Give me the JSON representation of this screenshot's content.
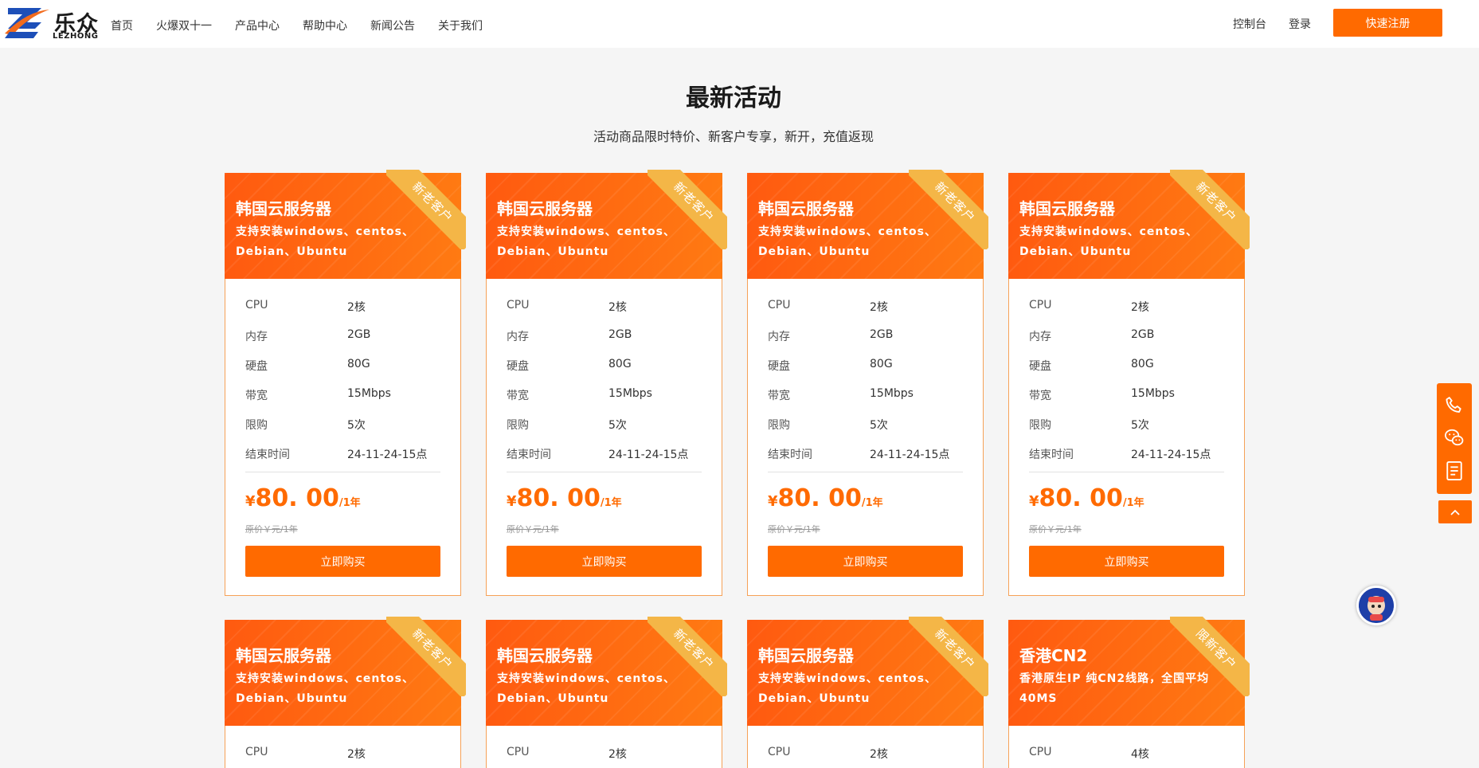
{
  "header": {
    "logo_text": "乐众",
    "logo_sub": "LEZHONG",
    "nav": [
      "首页",
      "火爆双十一",
      "产品中心",
      "帮助中心",
      "新闻公告",
      "关于我们"
    ],
    "console": "控制台",
    "login": "登录",
    "register": "快速注册"
  },
  "section": {
    "title": "最新活动",
    "subtitle": "活动商品限时特价、新客户专享，新开，充值返现"
  },
  "spec_labels": [
    "CPU",
    "内存",
    "硬盘",
    "带宽",
    "限购",
    "结束时间"
  ],
  "cards": [
    {
      "title": "韩国云服务器",
      "desc": "支持安装windows、centos、Debian、Ubuntu",
      "badge": "新老客户",
      "specs": [
        "2核",
        "2GB",
        "80G",
        "15Mbps",
        "5次",
        "24-11-24-15点"
      ],
      "currency": "¥",
      "price": "80. 00",
      "unit": "/1年",
      "original": "原价￥元/1年",
      "buy": "立即购买"
    },
    {
      "title": "韩国云服务器",
      "desc": "支持安装windows、centos、Debian、Ubuntu",
      "badge": "新老客户",
      "specs": [
        "2核",
        "2GB",
        "80G",
        "15Mbps",
        "5次",
        "24-11-24-15点"
      ],
      "currency": "¥",
      "price": "80. 00",
      "unit": "/1年",
      "original": "原价￥元/1年",
      "buy": "立即购买"
    },
    {
      "title": "韩国云服务器",
      "desc": "支持安装windows、centos、Debian、Ubuntu",
      "badge": "新老客户",
      "specs": [
        "2核",
        "2GB",
        "80G",
        "15Mbps",
        "5次",
        "24-11-24-15点"
      ],
      "currency": "¥",
      "price": "80. 00",
      "unit": "/1年",
      "original": "原价￥元/1年",
      "buy": "立即购买"
    },
    {
      "title": "韩国云服务器",
      "desc": "支持安装windows、centos、Debian、Ubuntu",
      "badge": "新老客户",
      "specs": [
        "2核",
        "2GB",
        "80G",
        "15Mbps",
        "5次",
        "24-11-24-15点"
      ],
      "currency": "¥",
      "price": "80. 00",
      "unit": "/1年",
      "original": "原价￥元/1年",
      "buy": "立即购买"
    },
    {
      "title": "韩国云服务器",
      "desc": "支持安装windows、centos、Debian、Ubuntu",
      "badge": "新老客户",
      "specs": [
        "2核"
      ]
    },
    {
      "title": "韩国云服务器",
      "desc": "支持安装windows、centos、Debian、Ubuntu",
      "badge": "新老客户",
      "specs": [
        "2核"
      ]
    },
    {
      "title": "韩国云服务器",
      "desc": "支持安装windows、centos、Debian、Ubuntu",
      "badge": "新老客户",
      "specs": [
        "2核"
      ]
    },
    {
      "title": "香港CN2",
      "desc": "香港原生IP 纯CN2线路，全国平均40MS",
      "badge": "限新客户",
      "specs": [
        "4核"
      ]
    }
  ],
  "colors": {
    "accent": "#ff6a00",
    "badge": "#f4b647",
    "mascot": "#1e3fa8"
  },
  "icons": [
    "phone-icon",
    "wechat-icon",
    "document-icon",
    "chevron-up-icon"
  ]
}
